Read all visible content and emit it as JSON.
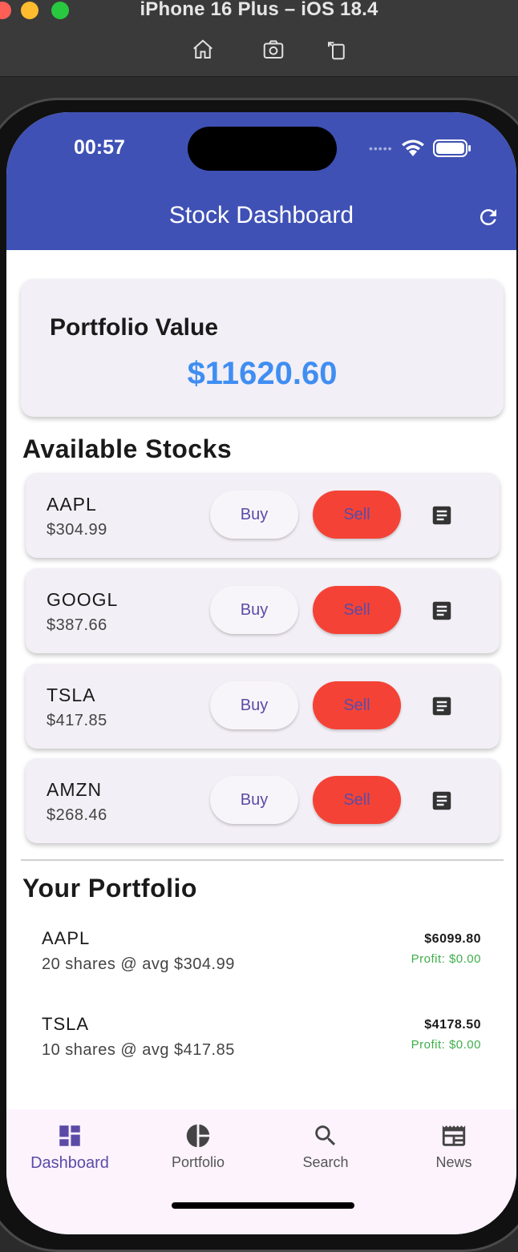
{
  "simulator": {
    "title": "iPhone 16 Plus – iOS 18.4",
    "tools": [
      {
        "icon": "home-icon"
      },
      {
        "icon": "screenshot-icon"
      },
      {
        "icon": "rotate-icon"
      }
    ]
  },
  "status_bar": {
    "time": "00:57"
  },
  "app_bar": {
    "title": "Stock Dashboard",
    "action_icon": "refresh-icon",
    "color": "#3f51b5"
  },
  "portfolio_card": {
    "title": "Portfolio Value",
    "value": "$11620.60",
    "value_color": "#3f8ef2"
  },
  "available_stocks": {
    "title": "Available Stocks",
    "buy_label": "Buy",
    "sell_label": "Sell",
    "sell_color": "#f44336",
    "items": [
      {
        "symbol": "AAPL",
        "price": "$304.99"
      },
      {
        "symbol": "GOOGL",
        "price": "$387.66"
      },
      {
        "symbol": "TSLA",
        "price": "$417.85"
      },
      {
        "symbol": "AMZN",
        "price": "$268.46"
      }
    ]
  },
  "your_portfolio": {
    "title": "Your Portfolio",
    "profit_color": "#3fae4b",
    "items": [
      {
        "symbol": "AAPL",
        "detail": "20 shares @ avg $304.99",
        "value": "$6099.80",
        "profit": "Profit: $0.00"
      },
      {
        "symbol": "TSLA",
        "detail": "10 shares @ avg $417.85",
        "value": "$4178.50",
        "profit": "Profit: $0.00"
      }
    ]
  },
  "bottom_nav": {
    "active": "Dashboard",
    "items": [
      {
        "label": "Dashboard",
        "icon": "dashboard-icon"
      },
      {
        "label": "Portfolio",
        "icon": "pie-chart-icon"
      },
      {
        "label": "Search",
        "icon": "search-icon"
      },
      {
        "label": "News",
        "icon": "news-icon"
      }
    ]
  }
}
